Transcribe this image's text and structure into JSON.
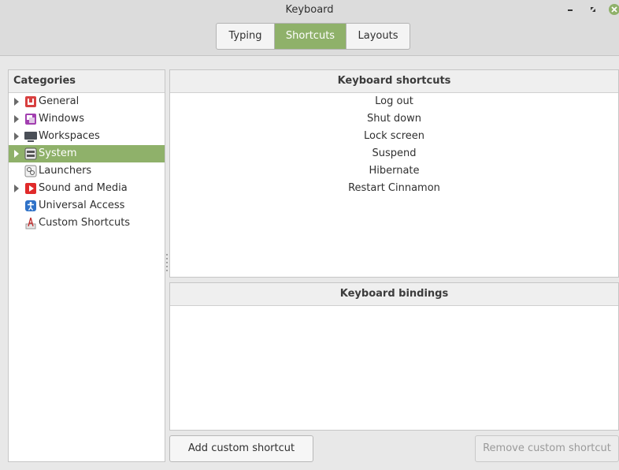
{
  "window": {
    "title": "Keyboard"
  },
  "tabs": [
    {
      "label": "Typing",
      "active": false
    },
    {
      "label": "Shortcuts",
      "active": true
    },
    {
      "label": "Layouts",
      "active": false
    }
  ],
  "categories": {
    "header": "Categories",
    "items": [
      {
        "label": "General",
        "icon": "general-icon",
        "expandable": true,
        "selected": false
      },
      {
        "label": "Windows",
        "icon": "windows-icon",
        "expandable": true,
        "selected": false
      },
      {
        "label": "Workspaces",
        "icon": "workspaces-icon",
        "expandable": true,
        "selected": false
      },
      {
        "label": "System",
        "icon": "system-icon",
        "expandable": true,
        "selected": true
      },
      {
        "label": "Launchers",
        "icon": "launchers-icon",
        "expandable": false,
        "selected": false
      },
      {
        "label": "Sound and Media",
        "icon": "sound-media-icon",
        "expandable": true,
        "selected": false
      },
      {
        "label": "Universal Access",
        "icon": "universal-access-icon",
        "expandable": false,
        "selected": false
      },
      {
        "label": "Custom Shortcuts",
        "icon": "custom-shortcuts-icon",
        "expandable": false,
        "selected": false
      }
    ]
  },
  "shortcuts": {
    "header": "Keyboard shortcuts",
    "items": [
      "Log out",
      "Shut down",
      "Lock screen",
      "Suspend",
      "Hibernate",
      "Restart Cinnamon"
    ]
  },
  "bindings": {
    "header": "Keyboard bindings"
  },
  "buttons": {
    "add": "Add custom shortcut",
    "remove": "Remove custom shortcut"
  },
  "colors": {
    "accent": "#8fb16a",
    "close": "#8fb16a"
  }
}
